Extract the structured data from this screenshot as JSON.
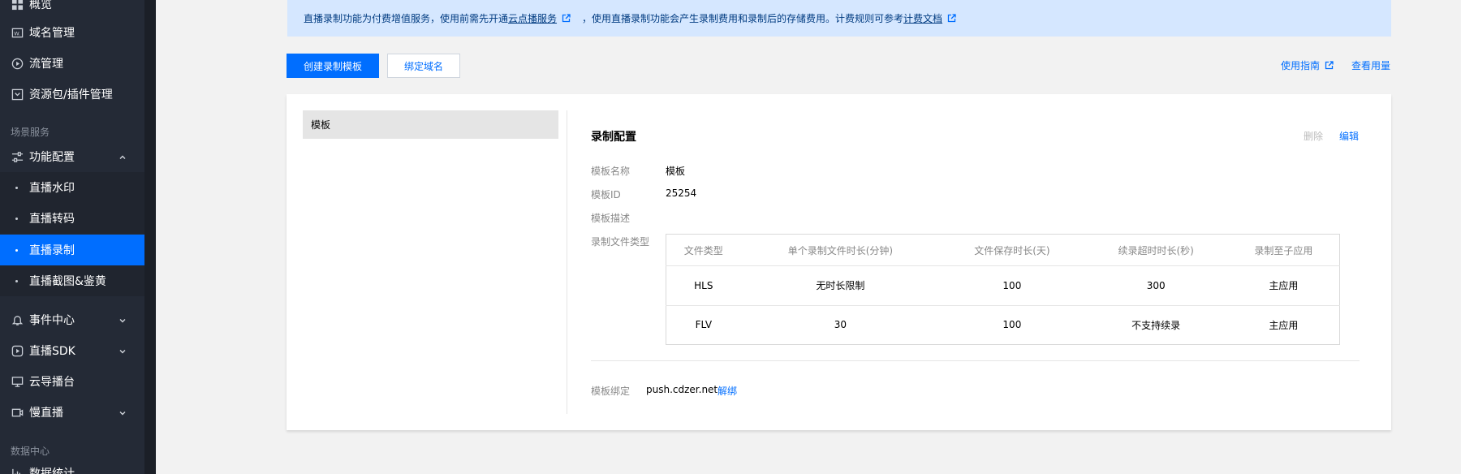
{
  "sidebar": {
    "items_top": [
      {
        "label": "概览",
        "icon": "grid-icon"
      },
      {
        "label": "域名管理",
        "icon": "domain-icon"
      },
      {
        "label": "流管理",
        "icon": "play-circle-icon"
      },
      {
        "label": "资源包/插件管理",
        "icon": "package-icon"
      }
    ],
    "section_scene": "场景服务",
    "feature_config": {
      "label": "功能配置",
      "icon": "sliders-icon"
    },
    "sub_items": [
      {
        "label": "直播水印"
      },
      {
        "label": "直播转码"
      },
      {
        "label": "直播录制",
        "active": true
      },
      {
        "label": "直播截图&鉴黄"
      }
    ],
    "items_bottom": [
      {
        "label": "事件中心",
        "icon": "bell-icon"
      },
      {
        "label": "直播SDK",
        "icon": "play-square-icon"
      },
      {
        "label": "云导播台",
        "icon": "monitor-icon"
      },
      {
        "label": "慢直播",
        "icon": "camera-icon"
      }
    ],
    "section_data": "数据中心",
    "last_item": "数据统计"
  },
  "notice": {
    "text1": "直播录制功能为付费增值服务，使用前需先开通",
    "link1": "云点播服务",
    "text2": "，使用直播录制功能会产生录制费用和录制后的存储费用。计费规则可参考",
    "link2": "计费文档"
  },
  "toolbar": {
    "create_label": "创建录制模板",
    "bind_label": "绑定域名",
    "guide_label": "使用指南",
    "usage_label": "查看用量"
  },
  "template_list": {
    "item": "模板"
  },
  "detail": {
    "title": "录制配置",
    "delete_label": "删除",
    "edit_label": "编辑",
    "name_label": "模板名称",
    "name_value": "模板",
    "id_label": "模板ID",
    "id_value": "25254",
    "desc_label": "模板描述",
    "filetype_label": "录制文件类型",
    "table": {
      "headers": [
        "文件类型",
        "单个录制文件时长(分钟)",
        "文件保存时长(天)",
        "续录超时时长(秒)",
        "录制至子应用"
      ],
      "rows": [
        [
          "HLS",
          "无时长限制",
          "100",
          "300",
          "主应用"
        ],
        [
          "FLV",
          "30",
          "100",
          "不支持续录",
          "主应用"
        ]
      ]
    },
    "bind_label": "模板绑定",
    "bind_domain": "push.cdzer.net",
    "unbind_label": "解绑"
  },
  "colors": {
    "accent": "#006eff",
    "sidebar_bg": "#242a36",
    "notice_bg": "#d5e7ff"
  }
}
